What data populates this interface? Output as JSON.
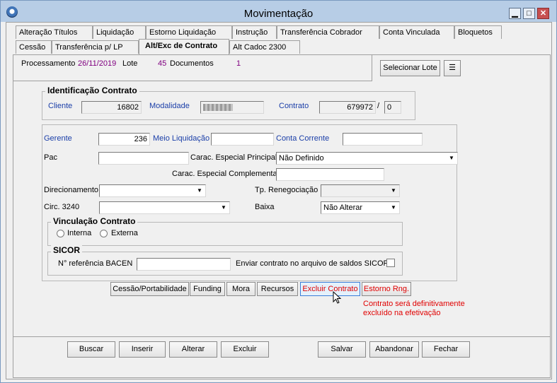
{
  "window": {
    "title": "Movimentação"
  },
  "tabs_row1": [
    "Alteração Títulos",
    "Liquidação",
    "Estorno Liquidação",
    "Instrução",
    "Transferência Cobrador",
    "Conta Vinculada",
    "Bloquetos"
  ],
  "tabs_row2": [
    "Cessão",
    "Transferência p/ LP",
    "Alt/Exc de Contrato",
    "Alt Cadoc 2300"
  ],
  "header": {
    "processamento_label": "Processamento",
    "processamento_value": "26/11/2019",
    "lote_label": "Lote",
    "lote_value": "45",
    "documentos_label": "Documentos",
    "documentos_value": "1",
    "selecionar_lote": "Selecionar Lote"
  },
  "identificacao": {
    "title": "Identificação Contrato",
    "cliente_label": "Cliente",
    "cliente_value": "16802",
    "modalidade_label": "Modalidade",
    "contrato_label": "Contrato",
    "contrato_value": "679972",
    "contrato_sep": "/",
    "contrato_digit": "0"
  },
  "form": {
    "gerente_label": "Gerente",
    "gerente_value": "236",
    "meio_liquidacao_label": "Meio Liquidação",
    "meio_liquidacao_value": "",
    "conta_corrente_label": "Conta Corrente",
    "conta_corrente_value": "",
    "pac_label": "Pac",
    "pac_value": "",
    "carac_principal_label": "Carac. Especial Principal",
    "carac_principal_value": "Não Definido",
    "carac_complementar_label": "Carac. Especial Complementar",
    "carac_complementar_value": "",
    "direcionamento_label": "Direcionamento",
    "direcionamento_value": "",
    "tp_renegociacao_label": "Tp. Renegociação",
    "tp_renegociacao_value": "",
    "circ_label": "Circ. 3240",
    "circ_value": "",
    "baixa_label": "Baixa",
    "baixa_value": "Não Alterar"
  },
  "vinculacao": {
    "title": "Vinculação Contrato",
    "interna": "Interna",
    "externa": "Externa"
  },
  "sicor": {
    "title": "SICOR",
    "ref_label": "N° referência BACEN",
    "ref_value": "",
    "enviar_label": "Enviar contrato no arquivo de saldos SICOR"
  },
  "actions": [
    "Cessão/Portabilidade",
    "Funding",
    "Mora",
    "Recursos",
    "Excluir Contrato",
    "Estorno Rng."
  ],
  "warning": {
    "line1": "Contrato será definitivamente",
    "line2": "excluído na efetivação"
  },
  "bottom_buttons": [
    "Buscar",
    "Inserir",
    "Alterar",
    "Excluir",
    "Salvar",
    "Abandonar",
    "Fechar"
  ],
  "colors": {
    "label_blue": "#1a3ea8",
    "value_purple": "#800080",
    "warning_red": "#e00000",
    "titlebar": "#b7cde6"
  }
}
